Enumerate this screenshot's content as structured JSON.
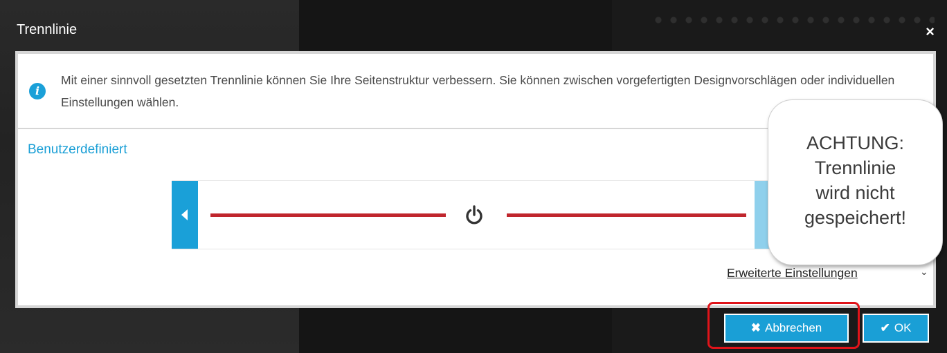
{
  "dialog": {
    "title": "Trennlinie",
    "close_symbol": "×",
    "info_text": "Mit einer sinnvoll gesetzten Trennlinie können Sie Ihre Seitenstruktur verbessern. Sie können zwischen vorgefertigten Designvorschlägen oder individuellen Einstellungen wählen.",
    "section_title": "Benutzerdefiniert",
    "extended_settings": "Erweiterte Einstellungen",
    "extended_chevron": "⌄"
  },
  "preview": {
    "line_color": "#c0262d",
    "center_icon": "power-icon"
  },
  "callout": {
    "text_lines": [
      "ACHTUNG:",
      "Trennlinie",
      "wird nicht",
      "gespeichert!"
    ]
  },
  "buttons": {
    "cancel_label": "Abbrechen",
    "cancel_icon": "✖",
    "ok_label": "OK",
    "ok_icon": "✔"
  },
  "colors": {
    "accent": "#1a9fd6",
    "highlight": "#e0141a"
  }
}
